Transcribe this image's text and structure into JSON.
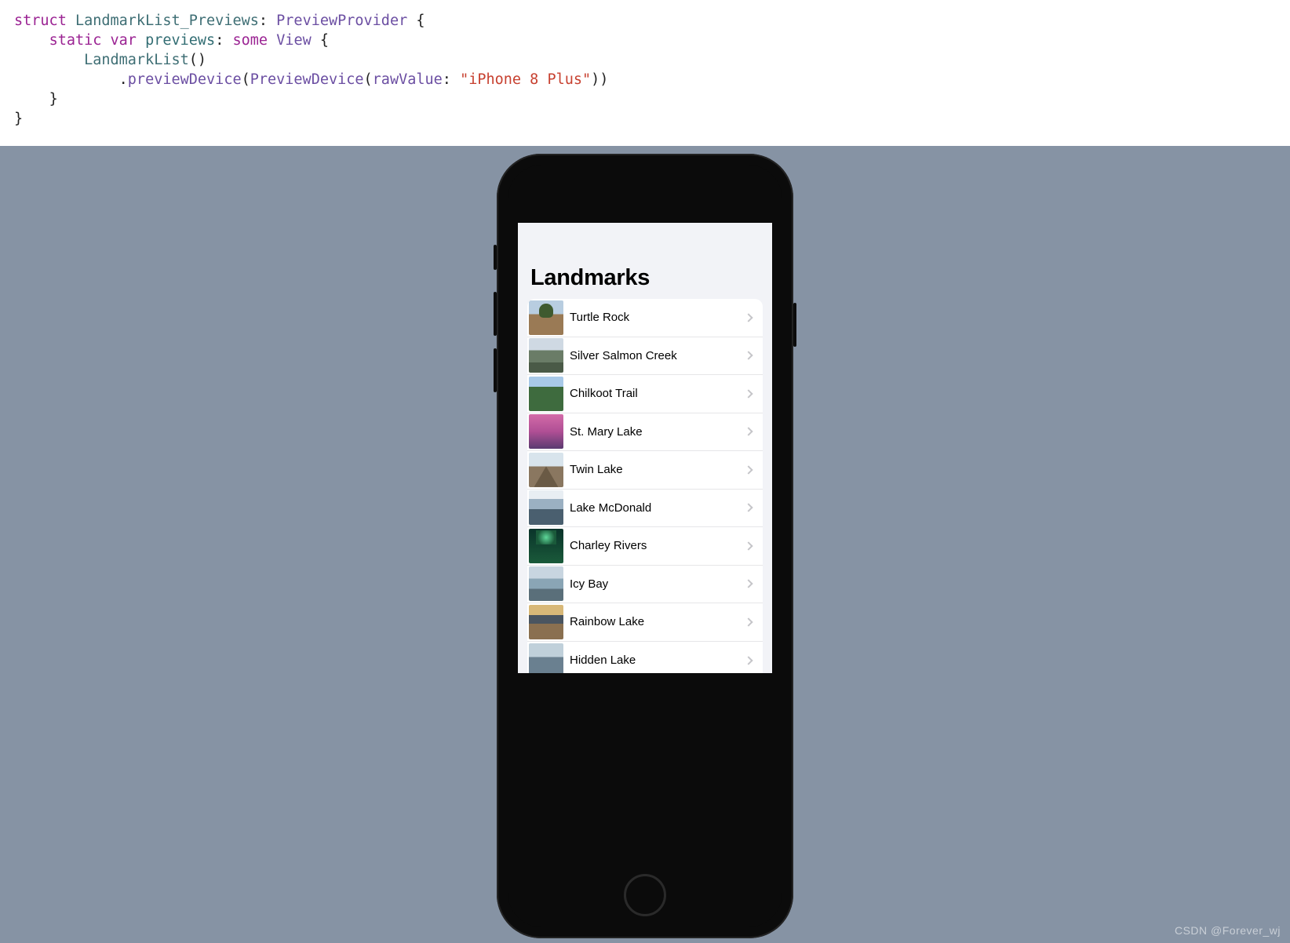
{
  "code": {
    "struct": "struct",
    "type_name": "LandmarkList_Previews",
    "colon": ":",
    "protocol": "PreviewProvider",
    "lbrace": "{",
    "static": "static",
    "var": "var",
    "prop": "previews",
    "some": "some",
    "view": "View",
    "call": "LandmarkList",
    "parens": "()",
    "dot": ".",
    "method": "previewDevice",
    "lparen": "(",
    "ptype": "PreviewDevice",
    "param": "rawValue",
    "str": "\"iPhone 8 Plus\"",
    "rparens": "))",
    "rbrace": "}"
  },
  "app": {
    "title": "Landmarks",
    "rows": [
      {
        "label": "Turtle Rock"
      },
      {
        "label": "Silver Salmon Creek"
      },
      {
        "label": "Chilkoot Trail"
      },
      {
        "label": "St. Mary Lake"
      },
      {
        "label": "Twin Lake"
      },
      {
        "label": "Lake McDonald"
      },
      {
        "label": "Charley Rivers"
      },
      {
        "label": "Icy Bay"
      },
      {
        "label": "Rainbow Lake"
      },
      {
        "label": "Hidden Lake"
      }
    ]
  },
  "watermark": "CSDN @Forever_wj"
}
